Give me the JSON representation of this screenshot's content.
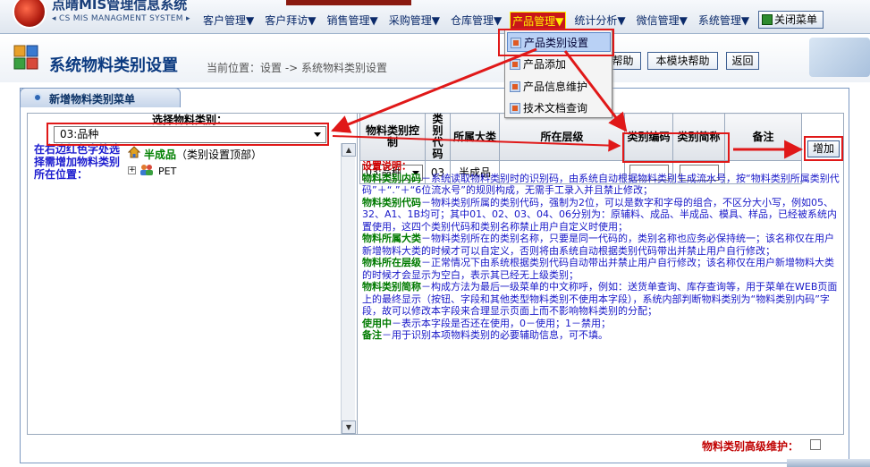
{
  "app": {
    "title": "点晴MIS管理信息系统",
    "subtitle": "CS MIS MANAGMENT SYSTEM"
  },
  "menu": [
    {
      "label": "客户管理▼"
    },
    {
      "label": "客户拜访▼"
    },
    {
      "label": "销售管理▼"
    },
    {
      "label": "采购管理▼"
    },
    {
      "label": "仓库管理▼"
    },
    {
      "label": "产品管理▼",
      "active": true
    },
    {
      "label": "统计分析▼"
    },
    {
      "label": "微信管理▼"
    },
    {
      "label": "系统管理▼"
    }
  ],
  "close_menu": "关闭菜单",
  "dropdown": [
    "产品类别设置",
    "产品添加",
    "产品信息维护",
    "技术文档查询"
  ],
  "page": {
    "title": "系统物料类别设置",
    "location": "当前位置：设置 -> 系统物料类别设置"
  },
  "toolbar": {
    "help": "帮助",
    "module_help": "本模块帮助",
    "back": "返回"
  },
  "panel": {
    "title": "新增物料类别菜单"
  },
  "left": {
    "select_label": "选择物料类别：",
    "select_value": "03:品种",
    "help_text": "在右边红色字处选择需增加物料类别所在位置：",
    "tree_root_name": "半成品",
    "tree_root_suffix": "（类别设置顶部）",
    "tree_child": "PET"
  },
  "table": {
    "headers": [
      "物料类别控制",
      "类别代码",
      "所属大类",
      "所在层级",
      "类别编码",
      "类别简称",
      "备注"
    ],
    "row": {
      "control": "03:品种",
      "code": "03",
      "category": "半成品"
    }
  },
  "add_button": "增加",
  "notes": [
    {
      "title": "设置说明：",
      "body": ""
    },
    {
      "title": "物料类别内码",
      "body": "－系统读取物料类别时的识别码，由系统自动根据物料类别生成流水号，按“物料类别所属类别代码”＋“.”＋“6位流水号”的规则构成，无需手工录入并且禁止修改；"
    },
    {
      "title": "物料类别代码",
      "body": "－物料类别所属的类别代码，强制为2位，可以是数字和字母的组合，不区分大小写，例如05、32、A1、1B均可；其中01、02、03、04、06分别为：原辅料、成品、半成品、模具、样品，已经被系统内置使用，这四个类别代码和类别名称禁止用户自定义时使用；"
    },
    {
      "title": "物料所属大类",
      "body": "－物料类别所在的类别名称，只要是同一代码的，类别名称也应务必保持统一；该名称仅在用户新增物料大类的时候才可以自定义，否则将由系统自动根据类别代码带出并禁止用户自行修改；"
    },
    {
      "title": "物料所在层级",
      "body": "－正常情况下由系统根据类别代码自动带出并禁止用户自行修改；该名称仅在用户新增物料大类的时候才会显示为空白，表示其已经无上级类别；"
    },
    {
      "title": "物料类别简称",
      "body": "－构成方法为最后一级菜单的中文称呼，例如：送货单查询、库存查询等，用于菜单在WEB页面上的最终显示（按钮、字段和其他类型物料类别不使用本字段），系统内部判断物料类别为“物料类别内码”字段，故可以修改本字段来合理显示页面上而不影响物料类别的分配；"
    },
    {
      "title": "使用中",
      "body": "－表示本字段是否还在使用，0－使用；1－禁用；"
    },
    {
      "title": "备注",
      "body": "－用于识别本项物料类别的必要辅助信息，可不填。"
    }
  ],
  "bottom": {
    "advanced_label": "物料类别高级维护："
  }
}
